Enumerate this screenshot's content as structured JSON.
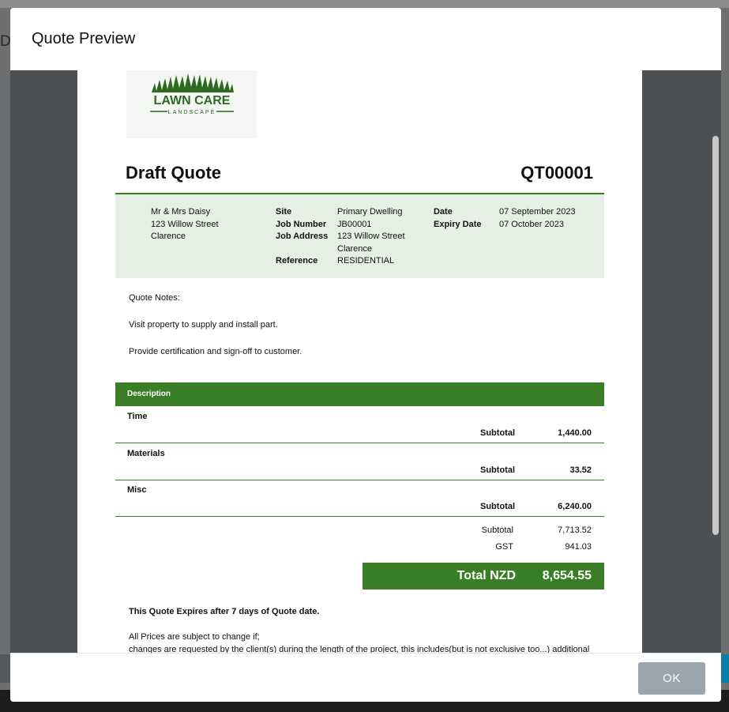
{
  "background": {
    "peek_text": "Do"
  },
  "modal": {
    "title": "Quote Preview",
    "ok_label": "OK"
  },
  "quote": {
    "logo_text_main": "LAWN CARE",
    "logo_text_sub": "LANDSCAPE",
    "title": "Draft Quote",
    "number": "QT00001",
    "client": [
      "Mr & Mrs Daisy",
      "123 Willow Street",
      "Clarence"
    ],
    "site_label": "Site",
    "site": "Primary Dwelling",
    "job_number_label": "Job Number",
    "job_number": "JB00001",
    "job_address_label": "Job Address",
    "job_address": [
      "123 Willow Street",
      "Clarence"
    ],
    "reference_label": "Reference",
    "reference": "RESIDENTIAL",
    "date_label": "Date",
    "date": "07 September 2023",
    "expiry_label": "Expiry Date",
    "expiry": "07 October 2023",
    "notes": [
      "Quote Notes:",
      "Visit property to supply and install part.",
      "Provide certification and sign-off to customer."
    ],
    "description_header": "Description",
    "sections": [
      {
        "name": "Time",
        "subtotal_label": "Subtotal",
        "subtotal": "1,440.00"
      },
      {
        "name": "Materials",
        "subtotal_label": "Subtotal",
        "subtotal": "33.52"
      },
      {
        "name": "Misc",
        "subtotal_label": "Subtotal",
        "subtotal": "6,240.00"
      }
    ],
    "subtotal_label": "Subtotal",
    "subtotal": "7,713.52",
    "gst_label": "GST",
    "gst": "941.03",
    "total_label": "Total NZD",
    "total": "8,654.55",
    "expires_note": "This Quote Expires after 7 days of Quote date.",
    "terms_line1": "All Prices are subject to change if;",
    "terms_line2": "changes are requested by the client(s) during the length of the project, this includes(but is not exclusive too...) additional"
  },
  "colors": {
    "brand_green": "#3a7d27",
    "info_bg": "#e6efe4",
    "ok_button": "#9aa6ad"
  }
}
